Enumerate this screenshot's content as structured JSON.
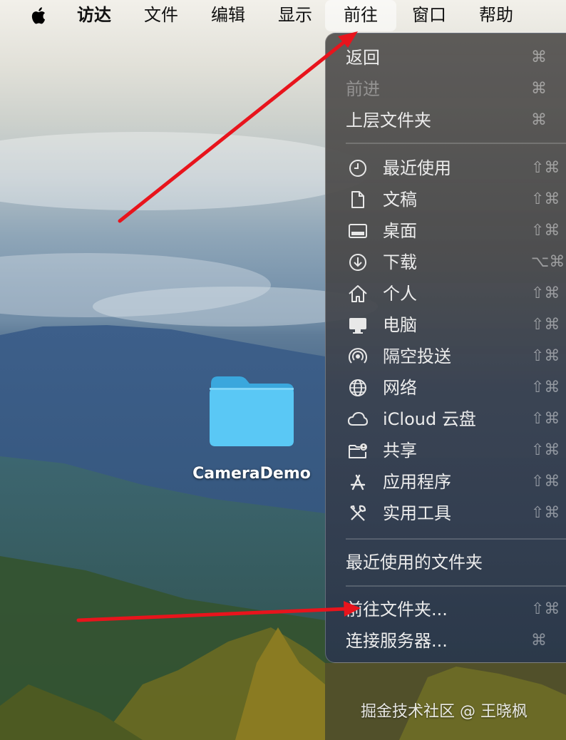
{
  "menubar": {
    "apple_icon": "apple-logo-icon",
    "items": [
      "访达",
      "文件",
      "编辑",
      "显示",
      "前往",
      "窗口",
      "帮助"
    ],
    "active_item": "前往"
  },
  "go_menu": {
    "nav": [
      {
        "label": "返回",
        "shortcut": "⌘",
        "enabled": true
      },
      {
        "label": "前进",
        "shortcut": "⌘",
        "enabled": false
      },
      {
        "label": "上层文件夹",
        "shortcut": "⌘",
        "enabled": true
      }
    ],
    "places": [
      {
        "label": "最近使用",
        "icon": "clock-icon",
        "shortcut": "⇧⌘"
      },
      {
        "label": "文稿",
        "icon": "document-icon",
        "shortcut": "⇧⌘"
      },
      {
        "label": "桌面",
        "icon": "desktop-icon",
        "shortcut": "⇧⌘"
      },
      {
        "label": "下载",
        "icon": "download-icon",
        "shortcut": "⌥⌘"
      },
      {
        "label": "个人",
        "icon": "home-icon",
        "shortcut": "⇧⌘"
      },
      {
        "label": "电脑",
        "icon": "computer-icon",
        "shortcut": "⇧⌘"
      },
      {
        "label": "隔空投送",
        "icon": "airdrop-icon",
        "shortcut": "⇧⌘"
      },
      {
        "label": "网络",
        "icon": "globe-icon",
        "shortcut": "⇧⌘"
      },
      {
        "label": "iCloud 云盘",
        "icon": "cloud-icon",
        "shortcut": "⇧⌘"
      },
      {
        "label": "共享",
        "icon": "shared-folder-icon",
        "shortcut": "⇧⌘"
      },
      {
        "label": "应用程序",
        "icon": "applications-icon",
        "shortcut": "⇧⌘"
      },
      {
        "label": "实用工具",
        "icon": "tools-icon",
        "shortcut": "⇧⌘"
      }
    ],
    "recent_folders": {
      "label": "最近使用的文件夹"
    },
    "go_to_folder": {
      "label": "前往文件夹...",
      "shortcut": "⇧⌘"
    },
    "connect_server": {
      "label": "连接服务器...",
      "shortcut": "⌘"
    }
  },
  "desktop": {
    "folder_name": "CameraDemo",
    "folder_color": "#5ac8f5"
  },
  "annotations": {
    "arrow_color": "#e8141c"
  },
  "watermark": "掘金技术社区 @ 王晓枫"
}
